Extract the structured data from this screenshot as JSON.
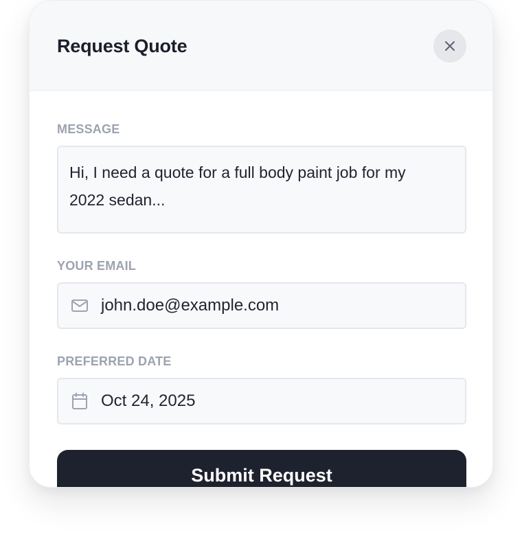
{
  "modal": {
    "title": "Request Quote",
    "close_icon": "close-icon"
  },
  "fields": {
    "message": {
      "label": "MESSAGE",
      "value": "Hi, I need a quote for a full body paint job for my\n2022 sedan..."
    },
    "email": {
      "label": "YOUR EMAIL",
      "icon": "mail-icon",
      "value": "john.doe@example.com"
    },
    "date": {
      "label": "PREFERRED DATE",
      "icon": "calendar-icon",
      "value": "Oct 24, 2025"
    }
  },
  "submit": {
    "label": "Submit Request"
  },
  "colors": {
    "primary_button": "#1e222e",
    "label": "#9ca3af",
    "field_bg": "#f8f9fb",
    "header_bg": "#f7f8fa"
  }
}
